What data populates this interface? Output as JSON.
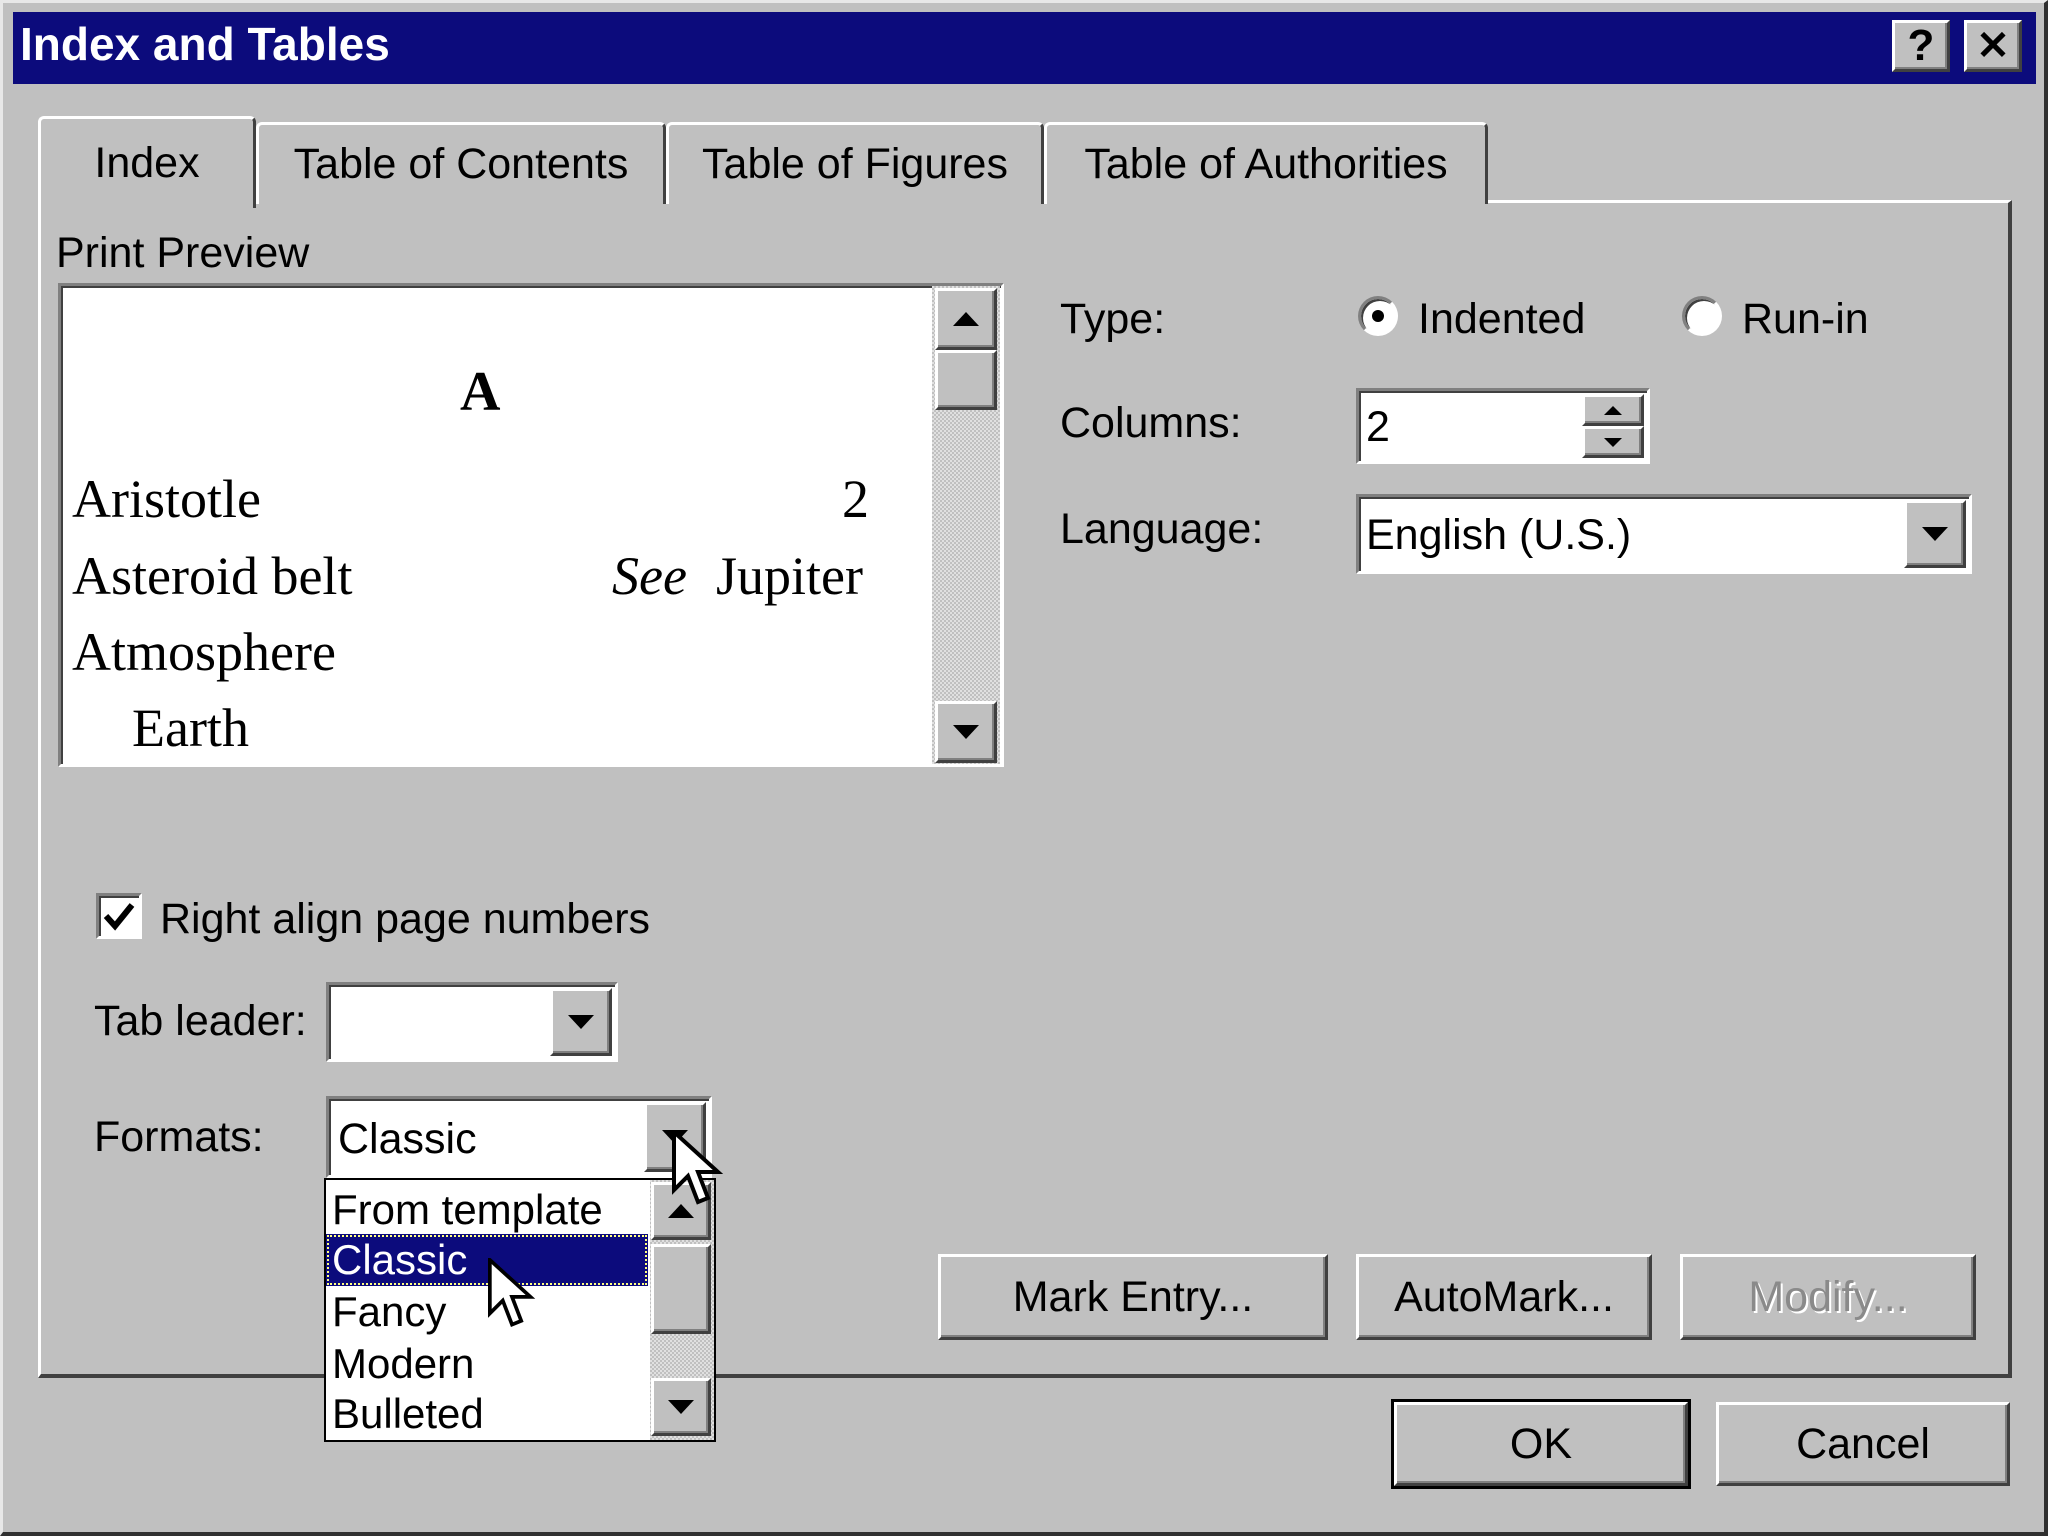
{
  "window": {
    "title": "Index and Tables",
    "help_btn": "?",
    "close_btn": "✕"
  },
  "tabs": [
    {
      "label": "Index",
      "active": true
    },
    {
      "label": "Table of Contents",
      "active": false
    },
    {
      "label": "Table of Figures",
      "active": false
    },
    {
      "label": "Table of Authorities",
      "active": false
    }
  ],
  "print_preview": {
    "label": "Print Preview",
    "heading": "A",
    "rows": [
      {
        "term": "Aristotle",
        "page": "2"
      },
      {
        "term": "Asteroid belt",
        "see": "See",
        "ref": "Jupiter"
      },
      {
        "term": "Atmosphere",
        "page": ""
      },
      {
        "term": "Earth",
        "page": ""
      }
    ]
  },
  "type": {
    "label": "Type:",
    "options": [
      "Indented",
      "Run-in"
    ],
    "selected": "Indented"
  },
  "columns": {
    "label": "Columns:",
    "value": "2"
  },
  "language": {
    "label": "Language:",
    "value": "English (U.S.)"
  },
  "right_align": {
    "label": "Right align page numbers",
    "checked": true
  },
  "tab_leader": {
    "label": "Tab leader:",
    "value": ""
  },
  "formats": {
    "label": "Formats:",
    "value": "Classic",
    "options": [
      "From template",
      "Classic",
      "Fancy",
      "Modern",
      "Bulleted"
    ],
    "highlighted": "Classic"
  },
  "buttons": {
    "mark_entry": "Mark Entry...",
    "automark": "AutoMark...",
    "modify": "Modify...",
    "ok": "OK",
    "cancel": "Cancel"
  },
  "colors": {
    "titlebar": "#0c0b7c",
    "face": "#c0c0c0",
    "selection": "#0c0b7c",
    "disabled_text": "#8a8a8a"
  },
  "icons": [
    "help-icon",
    "close-icon",
    "scroll-up-icon",
    "scroll-down-icon",
    "dropdown-arrow-icon",
    "spin-up-icon",
    "spin-down-icon",
    "checkmark-icon",
    "mouse-pointer-icon"
  ]
}
